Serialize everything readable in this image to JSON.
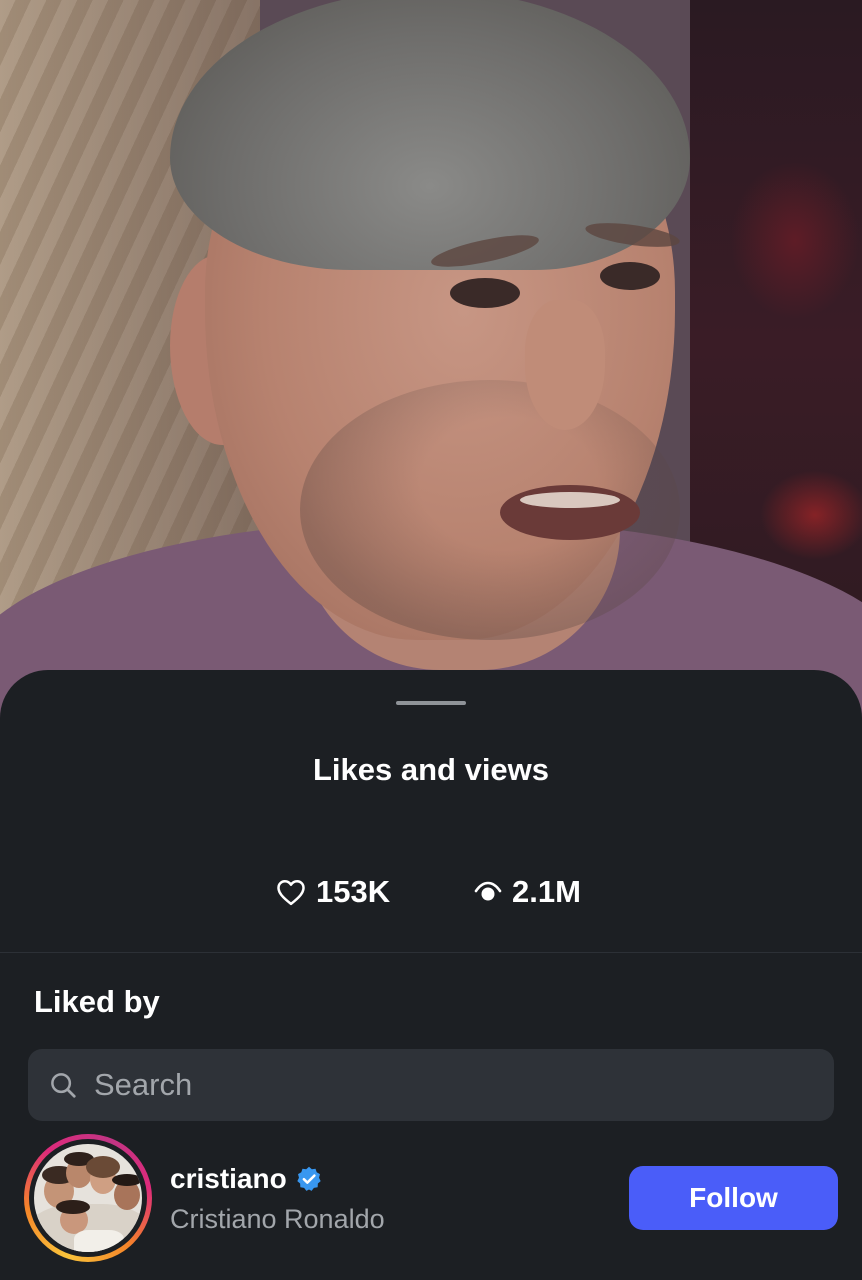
{
  "sheet": {
    "title": "Likes and views"
  },
  "stats": {
    "likes_icon": "heart-icon",
    "likes": "153K",
    "views_icon": "eye-icon",
    "views": "2.1M"
  },
  "liked_by": {
    "heading": "Liked by",
    "search": {
      "icon": "search-icon",
      "placeholder": "Search",
      "value": ""
    },
    "users": [
      {
        "username": "cristiano",
        "verified": true,
        "full_name": "Cristiano Ronaldo",
        "follow_label": "Follow"
      }
    ]
  },
  "colors": {
    "sheet_background": "#1c1f23",
    "search_background": "#2e3238",
    "follow_button": "#4a5df9",
    "verified_badge": "#3897f0",
    "secondary_text": "#a2a6ab"
  }
}
